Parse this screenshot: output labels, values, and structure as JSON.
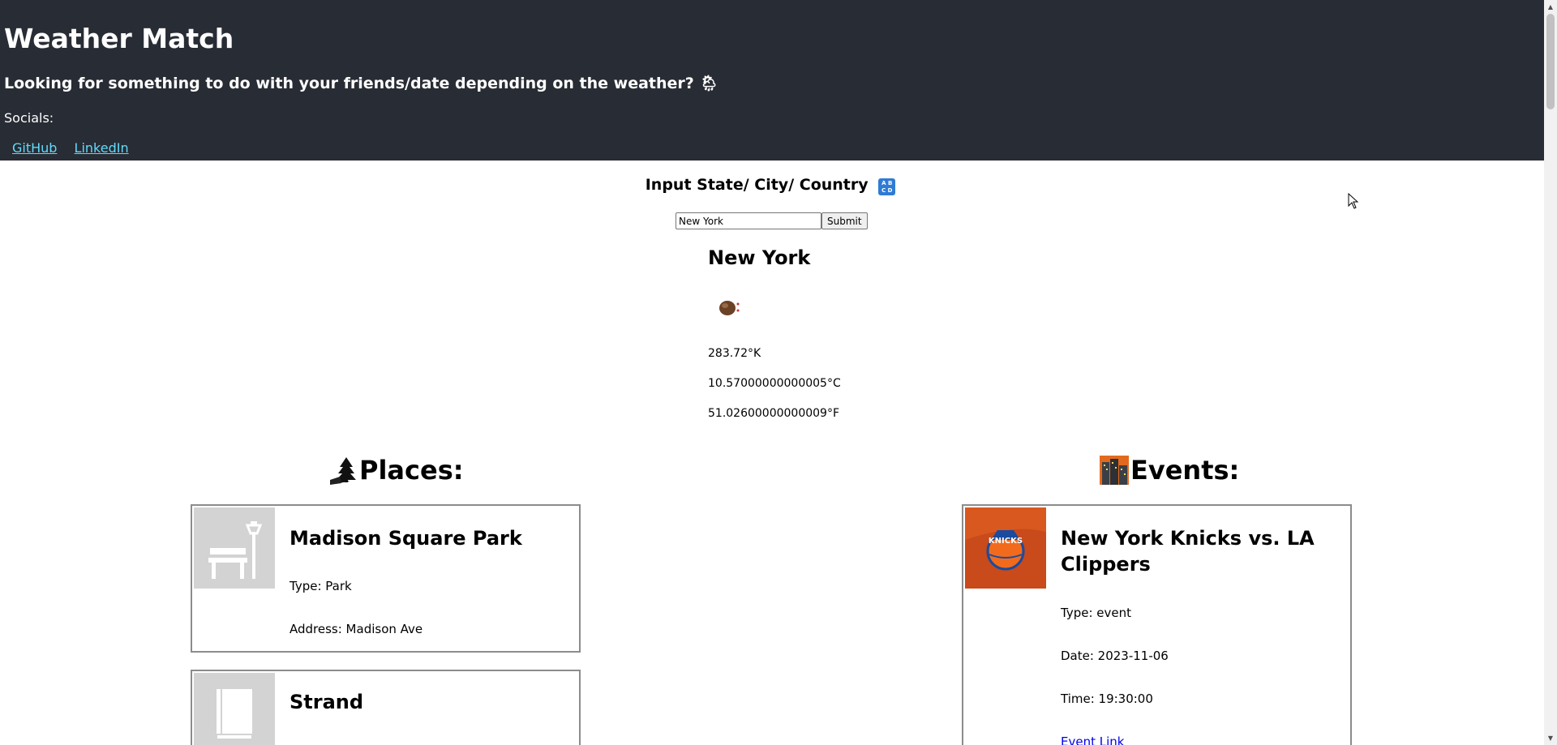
{
  "header": {
    "title": "Weather Match",
    "tagline": "Looking for something to do with your friends/date depending on the weather? 🌦",
    "socials_label": "Socials:",
    "links": [
      "GitHub",
      "LinkedIn"
    ]
  },
  "search": {
    "heading": "Input State/ City/ Country",
    "input_value": "New York",
    "submit_label": "Submit"
  },
  "weather": {
    "city": "New York",
    "icon": "weather-condition-icon",
    "kelvin": "283.72°K",
    "celsius": "10.57000000000005°C",
    "fahrenheit": "51.02600000000009°F"
  },
  "places": {
    "heading": "Places:",
    "icon": "park-landscape-icon",
    "items": [
      {
        "name": "Madison Square Park",
        "type": "Type: Park",
        "address": "Address: Madison Ave",
        "image_icon": "park-bench-icon"
      },
      {
        "name": "Strand",
        "image_icon": "book-icon"
      }
    ]
  },
  "events": {
    "heading": "Events:",
    "icon": "cityscape-icon",
    "items": [
      {
        "title_line1": "New York Knicks vs. LA",
        "title_line2": "Clippers",
        "type": "Type: event",
        "date": "Date: 2023-11-06",
        "time": "Time: 19:30:00",
        "link_label": "Event Link",
        "image_icon": "knicks-logo-icon"
      }
    ]
  },
  "colors": {
    "header_bg": "#282c34",
    "link": "#61dafb",
    "event_link": "#0000ee",
    "card_border": "#8c8c8c"
  }
}
